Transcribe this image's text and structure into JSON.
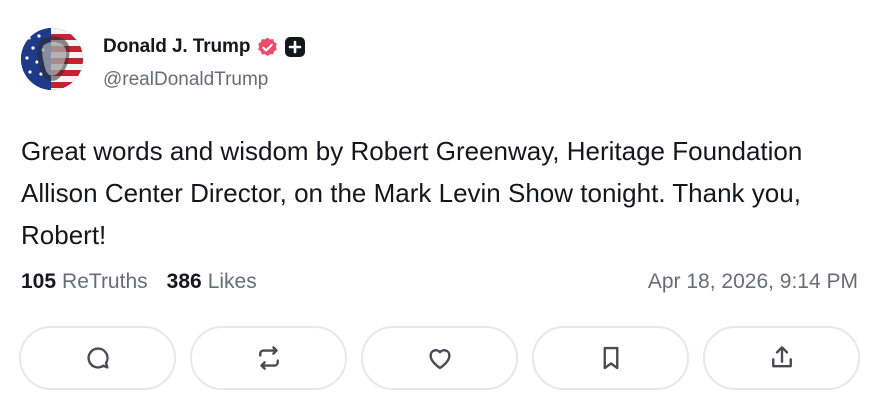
{
  "post": {
    "author": {
      "display_name": "Donald J. Trump",
      "handle": "@realDonaldTrump",
      "avatar_icon": "flag-portrait-avatar",
      "verified_icon": "verified-badge-icon",
      "plus_icon": "truth-plus-badge-icon",
      "verified_color": "#ed4c6b"
    },
    "text": "Great words and wisdom by Robert Greenway, Heritage Foundation Allison Center Director, on the Mark Levin Show tonight. Thank you, Robert!",
    "stats": {
      "retruths_count": "105",
      "retruths_label": "ReTruths",
      "likes_count": "386",
      "likes_label": "Likes"
    },
    "timestamp": "Apr 18, 2026, 9:14 PM",
    "actions": [
      {
        "icon": "reply-icon"
      },
      {
        "icon": "retruth-icon"
      },
      {
        "icon": "like-heart-icon"
      },
      {
        "icon": "bookmark-icon"
      },
      {
        "icon": "share-icon"
      }
    ]
  }
}
